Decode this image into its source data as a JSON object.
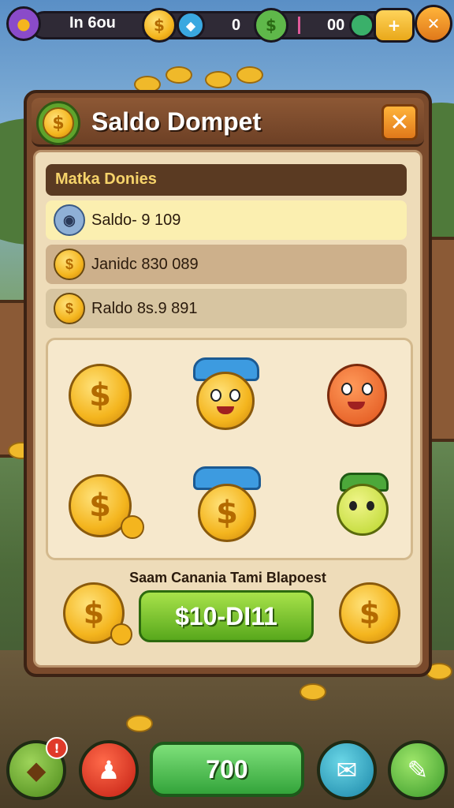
{
  "hud": {
    "player_label": "In 6ou",
    "gem_count": "0",
    "cash_count": "00"
  },
  "dialog": {
    "title": "Saldo Dompet",
    "close_symbol": "✕",
    "section_title": "Matka Donies",
    "rows": [
      {
        "label": "Saldo- 9 109",
        "icon": "eye-coin-icon"
      },
      {
        "label": "Janidc 830 089",
        "icon": "gold-coin-icon"
      },
      {
        "label": "Raldo 8s.9 891",
        "icon": "gold-coin-icon"
      }
    ],
    "subtitle": "Saam Canania Tami Blapoest",
    "price_button": "$10-DI11"
  },
  "bottom": {
    "main_button": "700",
    "badge": "!"
  },
  "colors": {
    "accent_green": "#58a81c",
    "gold": "#f4b51e",
    "panel": "#eedcb9",
    "frame": "#7a4a2c"
  }
}
